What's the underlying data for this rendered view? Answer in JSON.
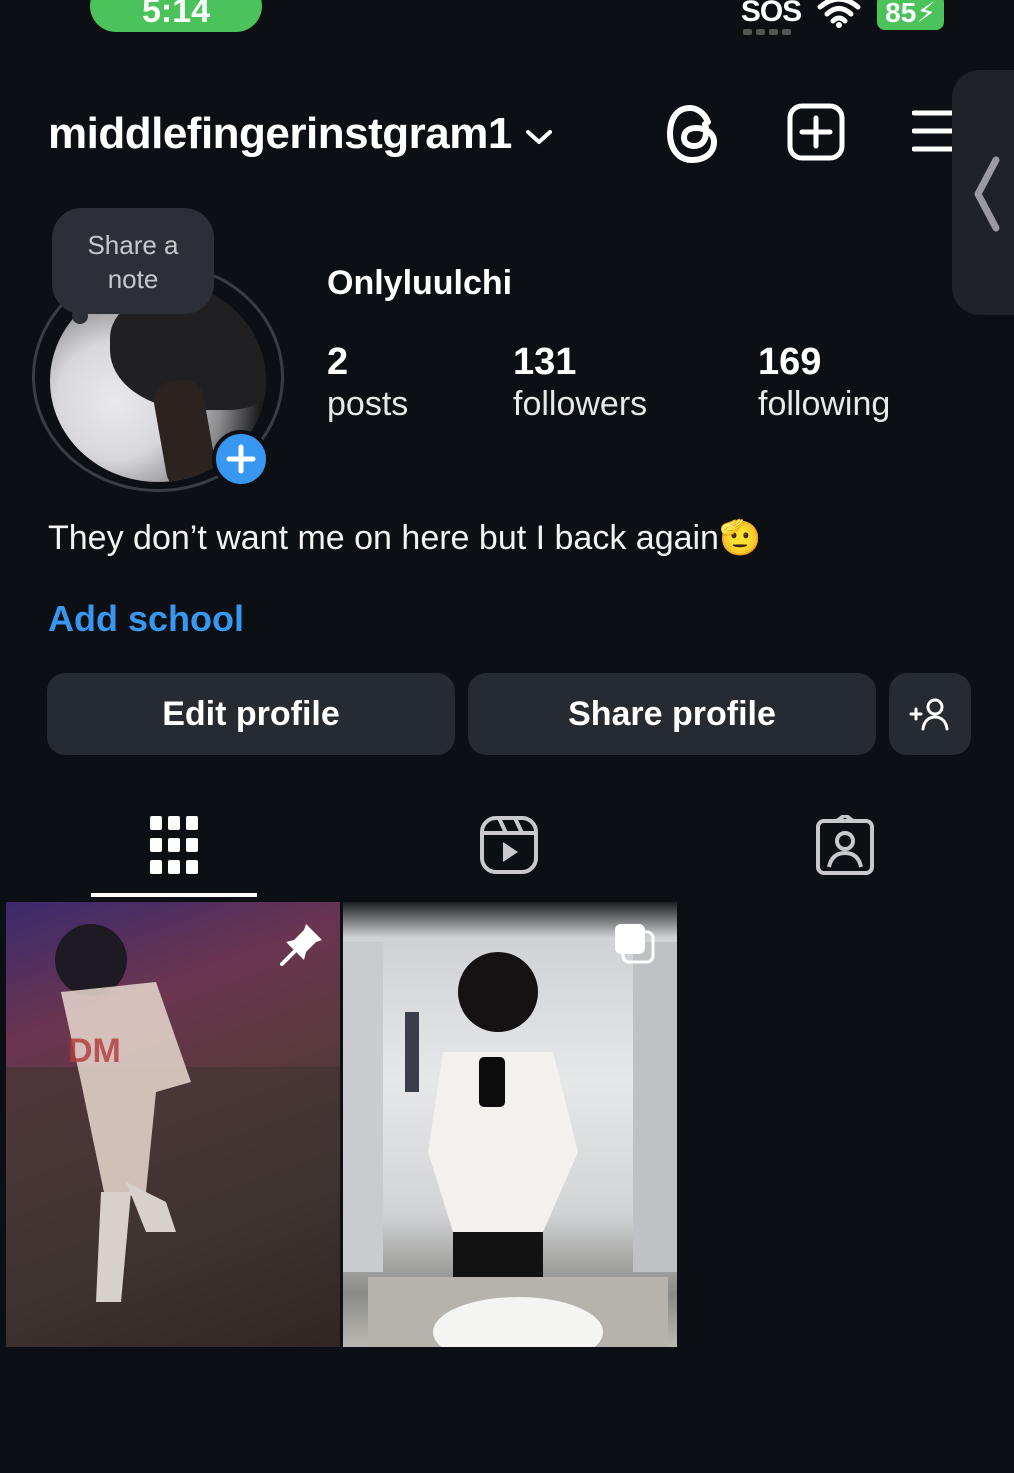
{
  "status_bar": {
    "time": "5:14",
    "sos": "SOS",
    "battery": "85"
  },
  "header": {
    "username": "middlefingerinstgram1"
  },
  "note": {
    "text_line1": "Share a",
    "text_line2": "note"
  },
  "profile": {
    "display_name": "Onlyluulchi",
    "stats": [
      {
        "value": "2",
        "label": "posts"
      },
      {
        "value": "131",
        "label": "followers"
      },
      {
        "value": "169",
        "label": "following"
      }
    ],
    "bio": "They don’t want me on here but I back again🫡",
    "add_school": "Add school"
  },
  "buttons": {
    "edit": "Edit profile",
    "share": "Share profile"
  },
  "tabs": [
    {
      "icon": "grid-icon",
      "active": true
    },
    {
      "icon": "reels-icon",
      "active": false
    },
    {
      "icon": "tagged-icon",
      "active": false
    }
  ],
  "posts": [
    {
      "badge": "pin-icon"
    },
    {
      "badge": "multiple-icon"
    }
  ]
}
